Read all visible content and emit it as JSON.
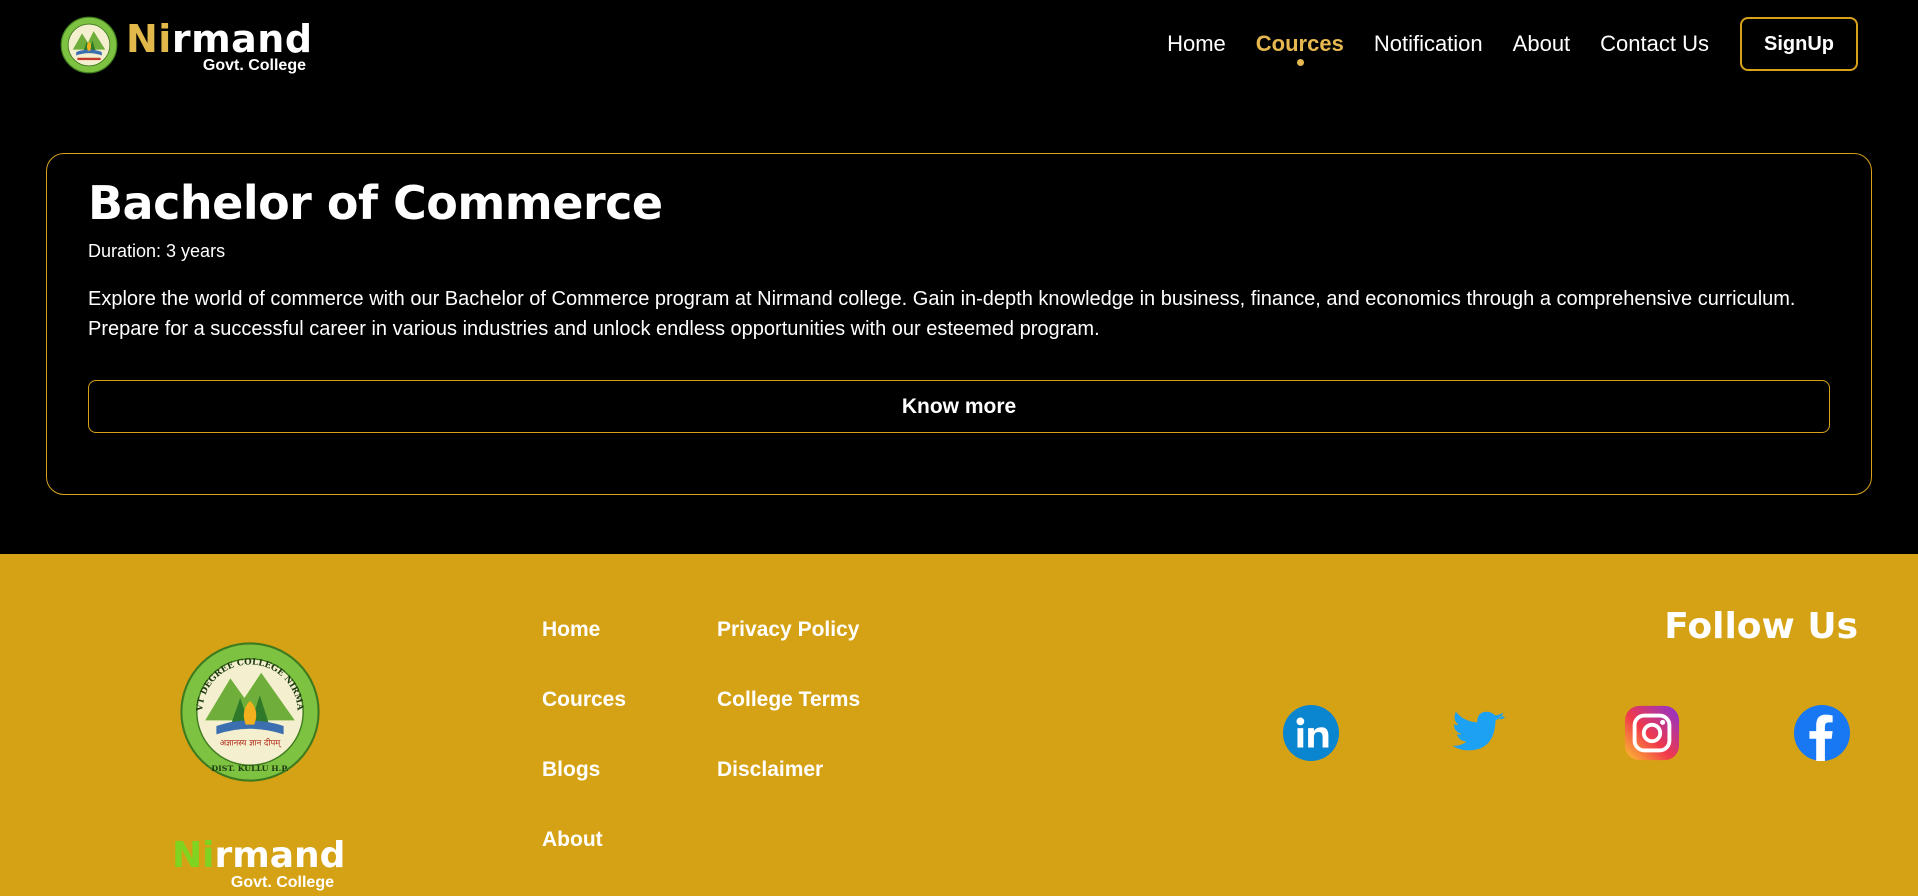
{
  "header": {
    "brand": {
      "word_highlight": "Ni",
      "word_rest": "rmand",
      "subtitle": "Govt. College"
    },
    "nav": [
      {
        "label": "Home",
        "active": false
      },
      {
        "label": "Cources",
        "active": true
      },
      {
        "label": "Notification",
        "active": false
      },
      {
        "label": "About",
        "active": false
      },
      {
        "label": "Contact Us",
        "active": false
      }
    ],
    "signup_label": "SignUp"
  },
  "course": {
    "title": "Bachelor of Commerce",
    "duration": "Duration: 3 years",
    "description": "Explore the world of commerce with our Bachelor of Commerce program at Nirmand college. Gain in-depth knowledge in business, finance, and economics through a comprehensive curriculum. Prepare for a successful career in various industries and unlock endless opportunities with our esteemed program.",
    "button_label": "Know more"
  },
  "footer": {
    "brand": {
      "word_highlight": "Ni",
      "word_rest": "rmand",
      "subtitle": "Govt. College"
    },
    "links_col1": [
      "Home",
      "Cources",
      "Blogs",
      "About"
    ],
    "links_col2": [
      "Privacy Policy",
      "College Terms",
      "Disclaimer"
    ],
    "follow_title": "Follow Us",
    "social": [
      "linkedin-icon",
      "twitter-icon",
      "instagram-icon",
      "facebook-icon"
    ]
  },
  "emblem": {
    "top_text": "GOVT DEGREE COLLEGE NIRMAND",
    "motto": "अज्ञानस्य ज्ञान दीपम्",
    "bottom_text": "DIST. KULLU H.P."
  },
  "colors": {
    "accent_gold": "#d6a21a",
    "nav_active": "#e6b84f",
    "footer_bg": "#d6a215",
    "brand_green": "#7fd321"
  }
}
